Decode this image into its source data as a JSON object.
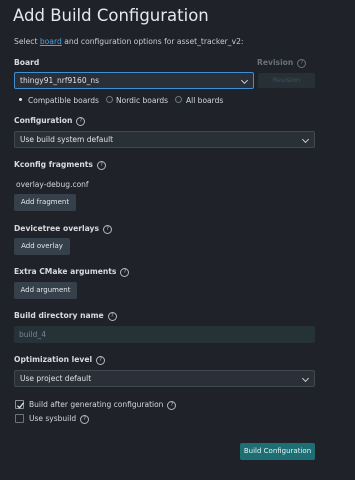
{
  "page": {
    "title": "Add Build Configuration",
    "subtitle_prefix": "Select ",
    "subtitle_link": "board",
    "subtitle_suffix": " and configuration options for asset_tracker_v2:"
  },
  "board": {
    "label": "Board",
    "value": "thingy91_nrf9160_ns",
    "revision_label": "Revision",
    "revision_placeholder": "Revision"
  },
  "board_filters": [
    {
      "label": "Compatible boards",
      "selected": true
    },
    {
      "label": "Nordic boards",
      "selected": false
    },
    {
      "label": "All boards",
      "selected": false
    }
  ],
  "configuration": {
    "label": "Configuration",
    "value": "Use build system default"
  },
  "kconfig": {
    "label": "Kconfig fragments",
    "items": [
      "overlay-debug.conf"
    ],
    "button": "Add fragment"
  },
  "devicetree": {
    "label": "Devicetree overlays",
    "button": "Add overlay"
  },
  "cmake": {
    "label": "Extra CMake arguments",
    "button": "Add argument"
  },
  "build_dir": {
    "label": "Build directory name",
    "value": "build_4"
  },
  "optimization": {
    "label": "Optimization level",
    "value": "Use project default"
  },
  "options": {
    "build_after": {
      "label": "Build after generating configuration",
      "checked": true
    },
    "sysbuild": {
      "label": "Use sysbuild",
      "checked": false
    }
  },
  "submit_label": "Build Configuration",
  "icons": {
    "help": "help-circle-icon",
    "chevron": "chevron-down-icon",
    "check": "check-icon"
  }
}
